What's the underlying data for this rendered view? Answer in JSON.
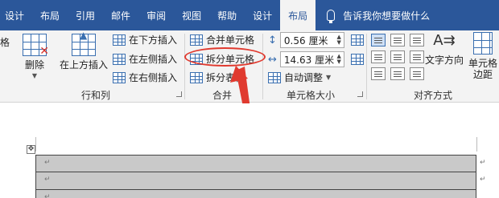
{
  "tabs": [
    {
      "label": "设计"
    },
    {
      "label": "布局"
    },
    {
      "label": "引用"
    },
    {
      "label": "邮件"
    },
    {
      "label": "审阅"
    },
    {
      "label": "视图"
    },
    {
      "label": "帮助"
    },
    {
      "label": "设计"
    },
    {
      "label": "布局"
    }
  ],
  "tell_me": "告诉我你想要做什么",
  "ribbon": {
    "clipped_left": "格",
    "rows_cols": {
      "delete": "删除",
      "insert_above": "在上方插入",
      "insert_below": "在下方插入",
      "insert_left": "在左侧插入",
      "insert_right": "在右侧插入",
      "label": "行和列"
    },
    "merge": {
      "merge_cells": "合并单元格",
      "split_cells": "拆分单元格",
      "split_table": "拆分表格",
      "label": "合并"
    },
    "cell_size": {
      "height_value": "0.56 厘米",
      "width_value": "14.63 厘米",
      "autofit": "自动调整",
      "label": "单元格大小"
    },
    "alignment": {
      "text_direction": "文字方向",
      "cell_margins": "单元格边距",
      "label": "对齐方式"
    }
  },
  "accent_color": "#2b579a",
  "annotation_color": "#e03a2f",
  "table": {
    "rows": [
      "↵",
      "↵",
      "↵"
    ],
    "end_marks": [
      "↵",
      "↵"
    ]
  }
}
